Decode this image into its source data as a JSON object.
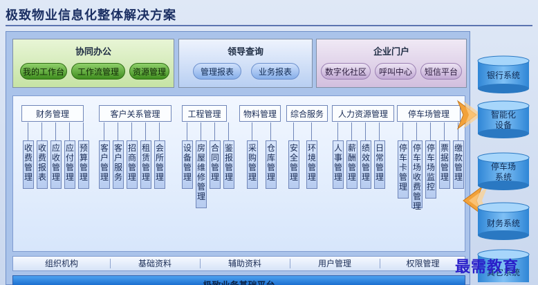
{
  "title": "极致物业信息化整体解决方案",
  "groups": [
    {
      "title": "协同办公",
      "items": [
        "我的工作台",
        "工作流管理",
        "资源管理"
      ]
    },
    {
      "title": "领导查询",
      "items": [
        "管理报表",
        "业务报表"
      ]
    },
    {
      "title": "企业门户",
      "items": [
        "数字化社区",
        "呼叫中心",
        "短信平台"
      ]
    }
  ],
  "categories": [
    "财务管理",
    "客户关系管理",
    "工程管理",
    "物料管理",
    "综合服务",
    "人力资源管理",
    "停车场管理"
  ],
  "modules": [
    "收费管理",
    "收费报表",
    "应收管理",
    "应付管理",
    "预算管理",
    "客户管理",
    "客户服务",
    "招商管理",
    "租赁管理",
    "会所管理",
    "设备管理",
    "房屋维修管理",
    "合同管理",
    "鉴报管理",
    "采购管理",
    "仓库管理",
    "安全管理",
    "环境管理",
    "人事管理",
    "薪酬管理",
    "绩效管理",
    "日常管理",
    "停车卡管理",
    "停车场收费管理",
    "停车场监控",
    "票据管理",
    "缴款管理"
  ],
  "bottom_bar": [
    "组织机构",
    "基础资料",
    "辅助资料",
    "用户管理",
    "权限管理"
  ],
  "footer_label": "极致业务基础平台",
  "right_systems": [
    "银行系统",
    "智能化设备",
    "停车场系统",
    "财务系统",
    "其它系统"
  ],
  "watermark": "最需教育",
  "colors": {
    "title": "#1b2f63",
    "green_pill": "#3f8d1e",
    "blue_pill": "#86aee9",
    "purple_pill": "#c1a9d4",
    "cylinder": "#2f86d6",
    "arrow": "#f2a23a",
    "watermark": "#2a1fc9"
  }
}
